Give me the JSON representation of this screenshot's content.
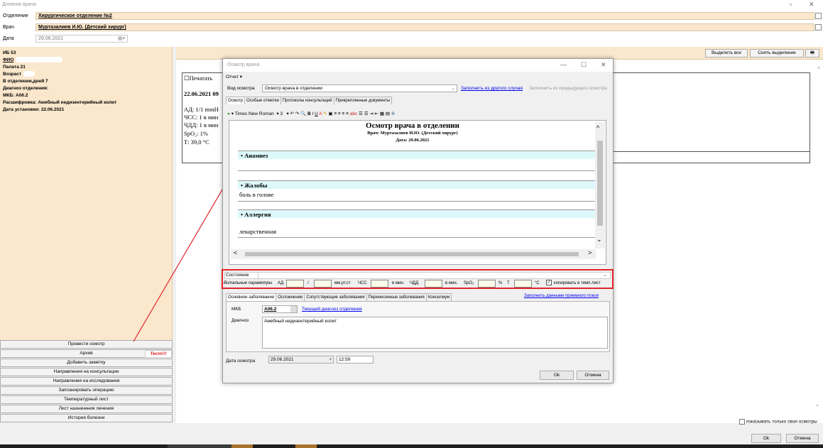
{
  "window": {
    "title": "Дневник врача"
  },
  "header": {
    "department_label": "Отделение",
    "department_value": "Хирургическое отделение №2",
    "doctor_label": "Врач",
    "doctor_value": "Муртазалиев И.Ю. (Детский хирург)",
    "date_label": "Дата",
    "date_value": "29.06.2021"
  },
  "patient": {
    "ib": "ИБ 53",
    "fio_label": "ФИО",
    "ward": "Палата 21",
    "age_label": "Возраст",
    "days": "В отделении,дней 7",
    "dept_diag": "Диагноз отделения:",
    "mkb": "МКБ: А06.2",
    "decode": "Расшифровка: Амебный недизентерийный колит",
    "install_date": "Дата установки: 22.06.2021"
  },
  "left_buttons": [
    "Провести осмотр",
    "Архив",
    "Добавить заметку",
    "Направления на консультации",
    "Направления на исследования",
    "Запланировать операцию",
    "Температурный лист",
    "Лист назначения лечения",
    "История болезни"
  ],
  "archive_badge": "Тест!!!",
  "right": {
    "select_all": "Выделить все",
    "deselect": "Снять выделение",
    "print_checkbox": "Печатать",
    "doc_lines": [
      "22.06.2021 09",
      "АД: 1/1 mmН",
      "ЧСС: 1 в мин",
      "ЧДД: 1 в мин",
      "SpO₂: 1%",
      "Т: 39,0 °С"
    ],
    "show_own": "показывать только свои осмотры"
  },
  "bottom": {
    "ok": "Ok",
    "cancel": "Отмена"
  },
  "dialog": {
    "title": "Осмотр врача",
    "menu_report": "Отчет ▾",
    "exam_type_label": "Вид осмотра",
    "exam_type_value": "Осмотр врача в отделении",
    "fill_other": "Заполнить из другого случая",
    "fill_prev": "Заполнить из предыдущего осмотра",
    "tabs": [
      "Осмотр",
      "Особые отметки",
      "Протоколы консультаций",
      "Прикрепленные документы"
    ],
    "font_name": "Times New Roman",
    "font_size": "3",
    "doc_title": "Осмотр врача в отделении",
    "doc_doctor": "Врач: Муртазалиев И.Ю. (Детский хирург)",
    "doc_date": "Дата: 29.06.2021",
    "sections": [
      {
        "title": "Анамнез",
        "text": ""
      },
      {
        "title": "Жалобы",
        "text": "боль в голове"
      },
      {
        "title": "Аллергия",
        "text": "лекарственная"
      }
    ],
    "state_label": "Состояние",
    "vitals": {
      "label": "Витальные параметры",
      "ad": "АД",
      "slash": "/",
      "mmhg": "мм.рт.ст",
      "chss": "ЧСС",
      "per_min1": "в мин.",
      "chdd": "ЧДД",
      "per_min2": "в мин.",
      "spo2": "SpO₂",
      "pct": "%",
      "t": "Т",
      "deg": "°С",
      "copy": "копировать в темп.лист"
    },
    "diag_tabs": [
      "Основное заболевание",
      "Осложнение",
      "Сопутствующие заболевания",
      "Перенесенные заболевания",
      "Консилиум"
    ],
    "fill_admission": "Заполнить данными приемного покоя",
    "mkb_label": "МКБ",
    "mkb_value": "А06.2",
    "current_diag": "Текущий диагноз отделения",
    "diag_label": "Диагноз",
    "diag_value": "Амебный недизентерийный колит",
    "exam_date_label": "Дата осмотра",
    "exam_date": "29.06.2021",
    "exam_time": "12:59",
    "ok": "Ok",
    "cancel": "Отмена"
  },
  "colors": {
    "accent_bg": "#fae7cc",
    "highlight_red": "#e0252a",
    "section_bg": "#dcf8fa"
  }
}
